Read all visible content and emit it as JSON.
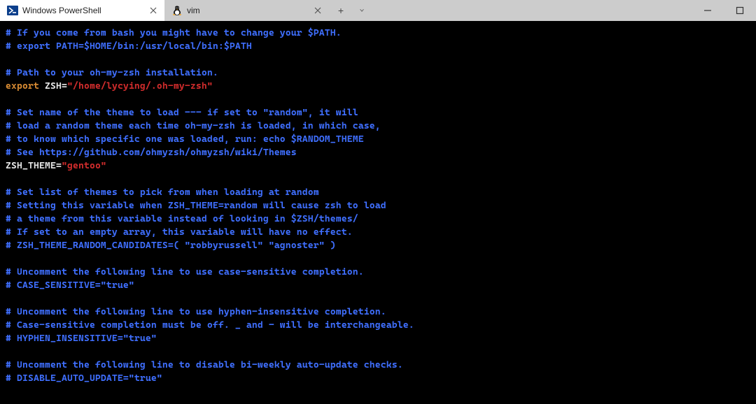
{
  "titlebar": {
    "tabs": [
      {
        "label": "Windows PowerShell",
        "icon": "powershell-icon",
        "active": true
      },
      {
        "label": "vim",
        "icon": "tux-icon",
        "active": false
      }
    ],
    "new_tab_label": "+",
    "dropdown_label": "▾",
    "minimize_label": "—",
    "maximize_label": "▢"
  },
  "editor": {
    "lines": [
      [
        {
          "cls": "c-comment",
          "t": "# If you come from bash you might have to change your $PATH."
        }
      ],
      [
        {
          "cls": "c-comment",
          "t": "# export PATH=$HOME/bin:/usr/local/bin:$PATH"
        }
      ],
      [],
      [
        {
          "cls": "c-comment",
          "t": "# Path to your oh-my-zsh installation."
        }
      ],
      [
        {
          "cls": "c-keyword",
          "t": "export"
        },
        {
          "cls": "",
          "t": " "
        },
        {
          "cls": "c-ident",
          "t": "ZSH"
        },
        {
          "cls": "c-eq",
          "t": "="
        },
        {
          "cls": "c-string",
          "t": "\"/home/lycying/.oh-my-zsh\""
        }
      ],
      [],
      [
        {
          "cls": "c-comment",
          "t": "# Set name of the theme to load --- if set to \"random\", it will"
        }
      ],
      [
        {
          "cls": "c-comment",
          "t": "# load a random theme each time oh-my-zsh is loaded, in which case,"
        }
      ],
      [
        {
          "cls": "c-comment",
          "t": "# to know which specific one was loaded, run: echo $RANDOM_THEME"
        }
      ],
      [
        {
          "cls": "c-comment",
          "t": "# See https://github.com/ohmyzsh/ohmyzsh/wiki/Themes"
        }
      ],
      [
        {
          "cls": "c-ident",
          "t": "ZSH_THEME"
        },
        {
          "cls": "c-eq",
          "t": "="
        },
        {
          "cls": "c-string",
          "t": "\"gentoo\""
        }
      ],
      [],
      [
        {
          "cls": "c-comment",
          "t": "# Set list of themes to pick from when loading at random"
        }
      ],
      [
        {
          "cls": "c-comment",
          "t": "# Setting this variable when ZSH_THEME=random will cause zsh to load"
        }
      ],
      [
        {
          "cls": "c-comment",
          "t": "# a theme from this variable instead of looking in $ZSH/themes/"
        }
      ],
      [
        {
          "cls": "c-comment",
          "t": "# If set to an empty array, this variable will have no effect."
        }
      ],
      [
        {
          "cls": "c-comment",
          "t": "# ZSH_THEME_RANDOM_CANDIDATES=( \"robbyrussell\" \"agnoster\" )"
        }
      ],
      [],
      [
        {
          "cls": "c-comment",
          "t": "# Uncomment the following line to use case-sensitive completion."
        }
      ],
      [
        {
          "cls": "c-comment",
          "t": "# CASE_SENSITIVE=\"true\""
        }
      ],
      [],
      [
        {
          "cls": "c-comment",
          "t": "# Uncomment the following line to use hyphen-insensitive completion."
        }
      ],
      [
        {
          "cls": "c-comment",
          "t": "# Case-sensitive completion must be off. _ and - will be interchangeable."
        }
      ],
      [
        {
          "cls": "c-comment",
          "t": "# HYPHEN_INSENSITIVE=\"true\""
        }
      ],
      [],
      [
        {
          "cls": "c-comment",
          "t": "# Uncomment the following line to disable bi-weekly auto-update checks."
        }
      ],
      [
        {
          "cls": "c-comment",
          "t": "# DISABLE_AUTO_UPDATE=\"true\""
        }
      ]
    ]
  }
}
